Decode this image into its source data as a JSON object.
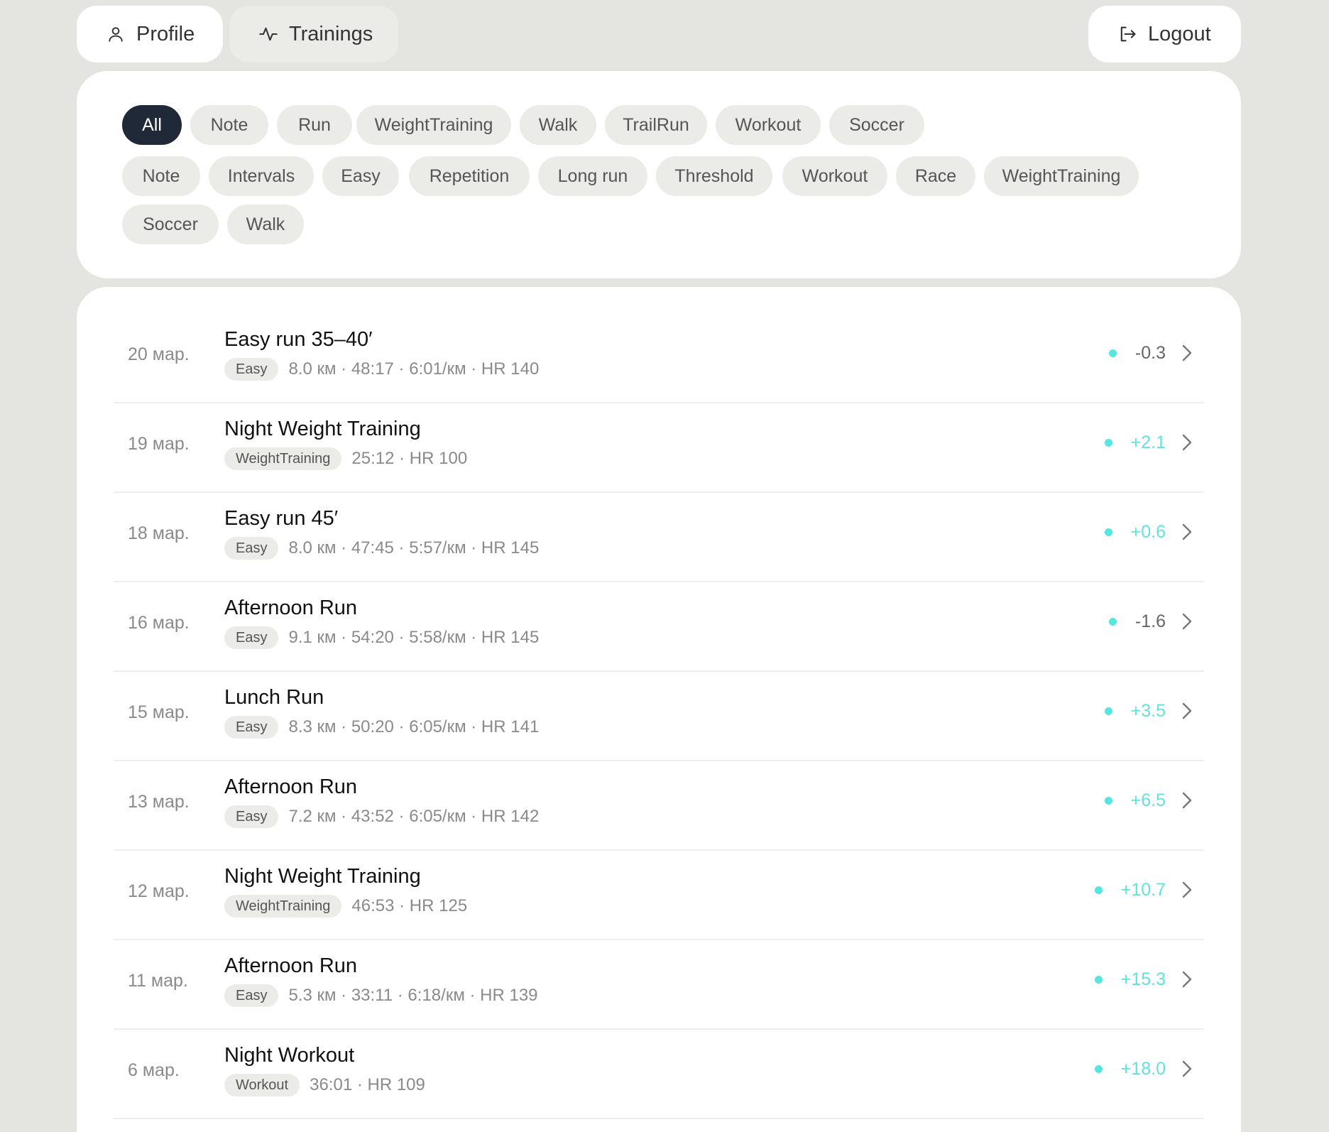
{
  "nav": {
    "profile_label": "Profile",
    "trainings_label": "Trainings",
    "logout_label": "Logout"
  },
  "filters": {
    "row1": [
      "All",
      "Note",
      "Run",
      "WeightTraining",
      "Walk",
      "TrailRun",
      "Workout",
      "Soccer"
    ],
    "row2": [
      "Note",
      "Intervals",
      "Easy",
      "Repetition",
      "Long run",
      "Threshold",
      "Workout",
      "Race",
      "WeightTraining"
    ],
    "row3": [
      "Soccer",
      "Walk"
    ],
    "active": "All"
  },
  "trainings": [
    {
      "date": "20 мар.",
      "title": "Easy run 35–40′",
      "tag": "Easy",
      "stats": "8.0 км · 48:17 · 6:01/км · HR 140",
      "delta": "-0.3"
    },
    {
      "date": "19 мар.",
      "title": "Night Weight Training",
      "tag": "WeightTraining",
      "stats": "25:12 · HR 100",
      "delta": "+2.1"
    },
    {
      "date": "18 мар.",
      "title": "Easy run 45′",
      "tag": "Easy",
      "stats": "8.0 км · 47:45 · 5:57/км · HR 145",
      "delta": "+0.6"
    },
    {
      "date": "16 мар.",
      "title": "Afternoon Run",
      "tag": "Easy",
      "stats": "9.1 км · 54:20 · 5:58/км · HR 145",
      "delta": "-1.6"
    },
    {
      "date": "15 мар.",
      "title": "Lunch Run",
      "tag": "Easy",
      "stats": "8.3 км · 50:20 · 6:05/км · HR 141",
      "delta": "+3.5"
    },
    {
      "date": "13 мар.",
      "title": "Afternoon Run",
      "tag": "Easy",
      "stats": "7.2 км · 43:52 · 6:05/км · HR 142",
      "delta": "+6.5"
    },
    {
      "date": "12 мар.",
      "title": "Night Weight Training",
      "tag": "WeightTraining",
      "stats": "46:53 · HR 125",
      "delta": "+10.7"
    },
    {
      "date": "11 мар.",
      "title": "Afternoon Run",
      "tag": "Easy",
      "stats": "5.3 км · 33:11 · 6:18/км · HR 139",
      "delta": "+15.3"
    },
    {
      "date": "6 мар.",
      "title": "Night Workout",
      "tag": "Workout",
      "stats": "36:01 · HR 109",
      "delta": "+18.0"
    }
  ],
  "colors": {
    "accent": "#5fe3dc",
    "active_chip": "#1f2937",
    "background": "#e4e4e0"
  }
}
